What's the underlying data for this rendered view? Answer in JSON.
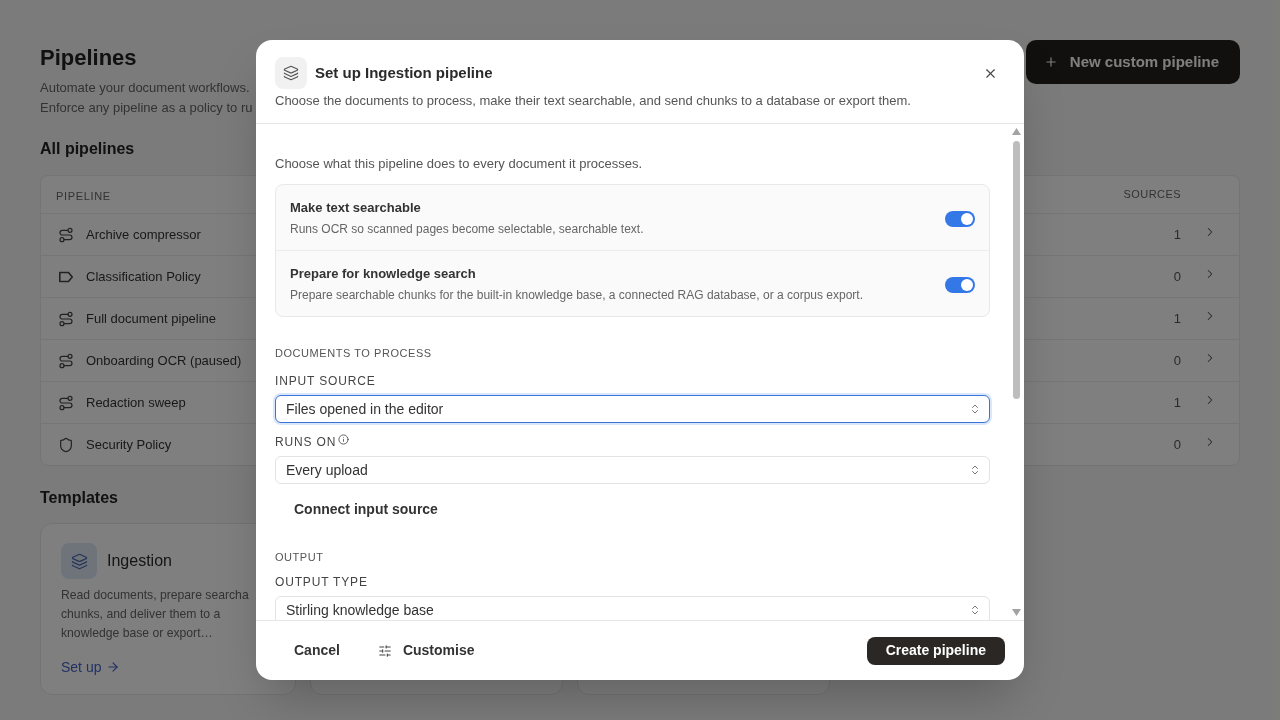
{
  "page": {
    "title": "Pipelines",
    "subtitle_lines": [
      "Automate your document workflows.",
      "Enforce any pipeline as a policy to ru"
    ],
    "new_button": "New custom pipeline"
  },
  "pipelines": {
    "heading": "All pipelines",
    "columns": [
      "PIPELINE",
      "SOURCES"
    ],
    "rows": [
      {
        "name": "Archive compressor",
        "kind": "route",
        "sources": "1"
      },
      {
        "name": "Classification Policy",
        "kind": "tag",
        "sources": "0"
      },
      {
        "name": "Full document pipeline",
        "kind": "route",
        "sources": "1"
      },
      {
        "name": "Onboarding OCR (paused)",
        "kind": "route",
        "sources": "0"
      },
      {
        "name": "Redaction sweep",
        "kind": "route",
        "sources": "1"
      },
      {
        "name": "Security Policy",
        "kind": "shield",
        "sources": "0"
      }
    ]
  },
  "templates": {
    "heading": "Templates",
    "cards": [
      {
        "kind": "template",
        "title": "Ingestion",
        "description_lines": [
          "Read documents, prepare searcha",
          "chunks, and deliver them to a",
          "knowledge base or export…"
        ],
        "link": "Set up"
      },
      {
        "kind": "blank"
      },
      {
        "kind": "blank"
      }
    ]
  },
  "dialog": {
    "title": "Set up Ingestion pipeline",
    "subtitle": "Choose the documents to process, make their text searchable, and send chunks to a database or export them.",
    "intro": "Choose what this pipeline does to every document it processes.",
    "options": [
      {
        "title": "Make text searchable",
        "description": "Runs OCR so scanned pages become selectable, searchable text.",
        "on": true
      },
      {
        "title": "Prepare for knowledge search",
        "description": "Prepare searchable chunks for the built-in knowledge base, a connected RAG database, or a corpus export.",
        "on": true
      }
    ],
    "documents": {
      "heading": "DOCUMENTS TO PROCESS",
      "input_source": {
        "label": "INPUT SOURCE",
        "value": "Files opened in the editor",
        "focused": true
      },
      "runs_on": {
        "label": "RUNS ON",
        "value": "Every upload",
        "focused": false
      },
      "connect_button": "Connect input source"
    },
    "output": {
      "heading": "OUTPUT",
      "output_type": {
        "label": "OUTPUT TYPE",
        "value": "Stirling knowledge base",
        "focused": false
      }
    },
    "footer": {
      "cancel": "Cancel",
      "customise": "Customise",
      "create": "Create pipeline"
    }
  }
}
